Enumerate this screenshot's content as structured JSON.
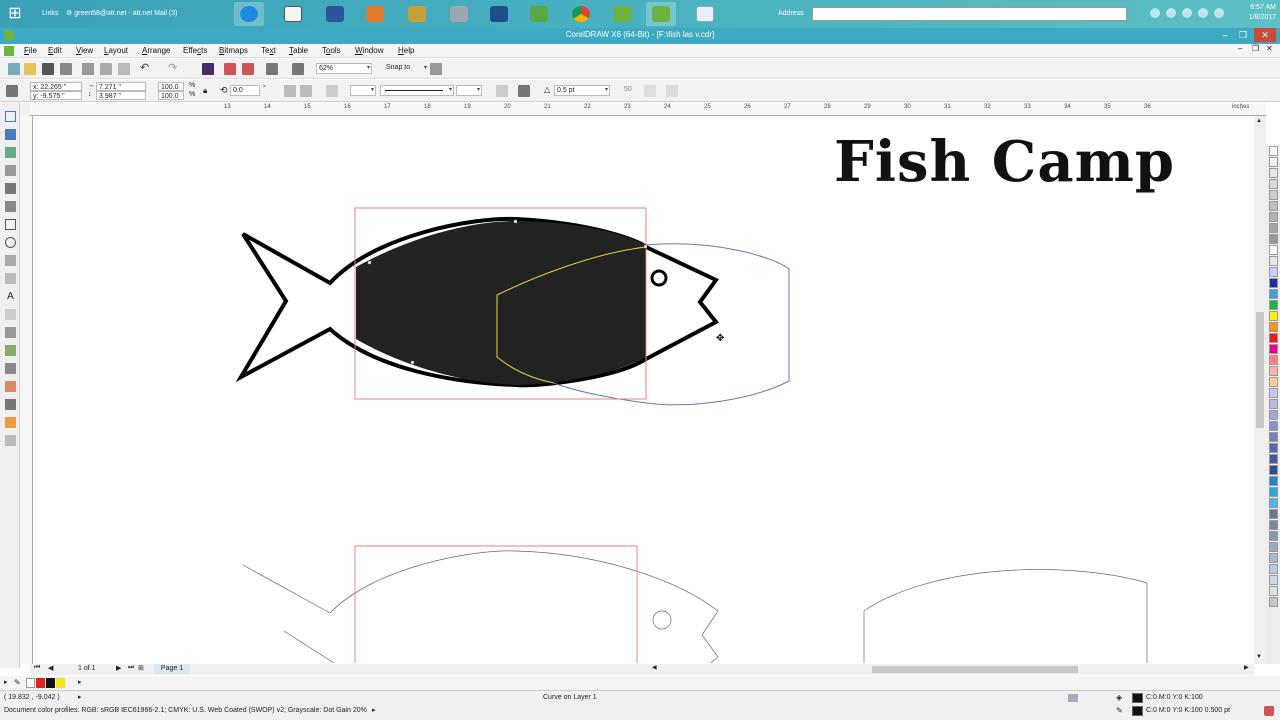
{
  "taskbar": {
    "links_label": "Links",
    "mail_label": "green58@att.net - att.net Mail (3)",
    "address_label": "Address",
    "clock_time": "6:57 AM",
    "clock_date": "1/8/2017"
  },
  "window": {
    "title": "CorelDRAW X6 (64-Bit) - [F:\\fish las v.cdr]"
  },
  "menu": {
    "items": [
      {
        "pre": "",
        "u": "F",
        "post": "ile"
      },
      {
        "pre": "",
        "u": "E",
        "post": "dit"
      },
      {
        "pre": "",
        "u": "V",
        "post": "iew"
      },
      {
        "pre": "",
        "u": "L",
        "post": "ayout"
      },
      {
        "pre": "",
        "u": "A",
        "post": "rrange"
      },
      {
        "pre": "Effe",
        "u": "c",
        "post": "ts"
      },
      {
        "pre": "",
        "u": "B",
        "post": "itmaps"
      },
      {
        "pre": "Te",
        "u": "x",
        "post": "t"
      },
      {
        "pre": "",
        "u": "T",
        "post": "able"
      },
      {
        "pre": "T",
        "u": "o",
        "post": "ols"
      },
      {
        "pre": "",
        "u": "W",
        "post": "indow"
      },
      {
        "pre": "",
        "u": "H",
        "post": "elp"
      }
    ]
  },
  "standard_toolbar": {
    "zoom": "62%",
    "snap_to": "Snap to"
  },
  "property_bar": {
    "x": "x: 22.265 \"",
    "y": "y: -9.575 \"",
    "width": "7.271 \"",
    "height": "3.987 \"",
    "scale_w": "100.0",
    "scale_h": "100.0",
    "percent": "%",
    "rotation": "0.0",
    "degree": "°",
    "outline_width": "0.5 pt",
    "value_50": "50"
  },
  "rulers": {
    "unit": "inches",
    "h_ticks": [
      "13",
      "14",
      "15",
      "16",
      "17",
      "18",
      "19",
      "20",
      "21",
      "22",
      "23",
      "24",
      "25",
      "26",
      "27",
      "28",
      "29",
      "30",
      "31",
      "32",
      "33",
      "34",
      "35",
      "36"
    ]
  },
  "canvas": {
    "heading": "Fish Camp"
  },
  "page_nav": {
    "counter": "1 of 1",
    "page_tab": "Page 1"
  },
  "status": {
    "coords": "( 19.832 , -9.042 )",
    "selection": "Curve on Layer 1",
    "fill_info": "C:0 M:0 Y:0 K:100",
    "outline_info": "C:0 M:0 Y:0 K:100  0.500 pt",
    "color_profile": "Document color profiles: RGB: sRGB IEC61966-2.1; CMYK: U.S. Web Coated (SWOP) v2; Grayscale: Dot Gain 20%"
  },
  "colors": {
    "accent": "#3da9c3",
    "fish_fill": "#222222",
    "selection_red": "#e8847c"
  }
}
